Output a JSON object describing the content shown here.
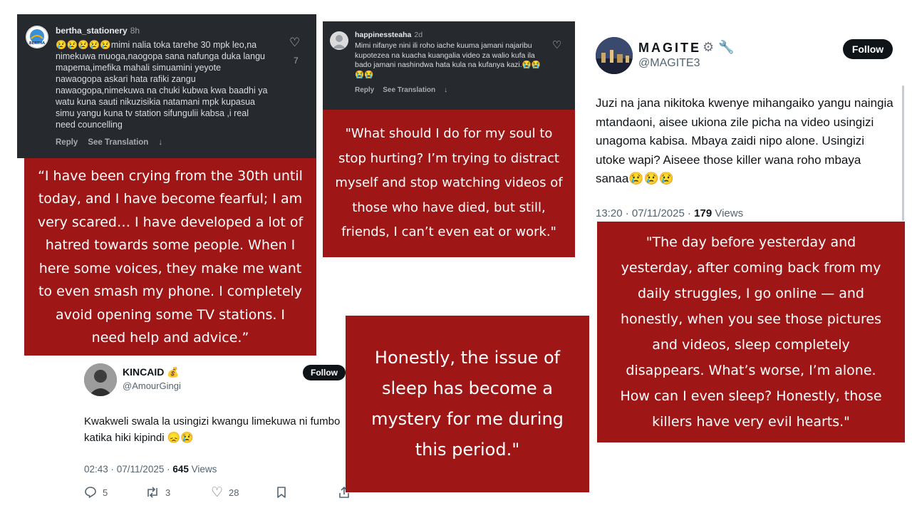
{
  "comment_bertha": {
    "username": "bertha_stationery",
    "time": "8h",
    "text": "😢😢😢😢😢mimi nalia toka tarehe 30 mpk leo,na nimekuwa muoga,naogopa sana nafunga duka langu mapema,imefika mahali simuamini yeyote nawaogopa askari hata rafiki zangu nawaogopa,nimekuwa na chuki kubwa kwa baadhi ya watu kuna sauti nikuzisikia natamani mpk kupasua simu yangu kuna tv station sifungulii kabsa ,i real need councelling",
    "likes": "7",
    "reply_label": "Reply",
    "translate_label": "See Translation",
    "avatar_label": "BERTHA"
  },
  "translation_bertha": "“I have been crying from the 30th until today, and I have become fearful; I am very scared… I have developed a lot of hatred towards some people. When I here some voices, they  make me want to even smash my phone. I completely avoid opening some TV stations. I need help and advice.”",
  "comment_happiness": {
    "username": "happinessteaha",
    "time": "2d",
    "text": "Mimi nifanye nini ili roho iache kuuma jamani najaribu kupotezea na kuacha kuangalia video za walio kufa ila bado jamani nashindwa hata kula na kufanya kazi.😭😭😭😭",
    "reply_label": "Reply",
    "translate_label": "See Translation"
  },
  "translation_happiness": "\"What should I do for my soul to stop hurting? I’m trying to distract myself and stop watching videos of those who have died, but still, friends, I can’t even eat or work.\"",
  "tweet_magite": {
    "name": "MAGITE",
    "name_icons": "⚙️🔧",
    "handle": "@MAGITE3",
    "follow_label": "Follow",
    "text": "Juzi na jana nikitoka kwenye mihangaiko yangu naingia mtandaoni, aisee ukiona zile picha na video usingizi unagoma kabisa. Mbaya zaidi nipo alone. Usingizi utoke wapi? Aiseee those killer wana roho mbaya sanaa😢😢😢",
    "timestamp": "13:20 · 07/11/2025 · ",
    "views_count": "179",
    "views_label": " Views"
  },
  "translation_magite": "\"The day before yesterday and yesterday, after coming back from my daily struggles, I go online — and honestly, when you see those pictures and videos, sleep completely disappears. What’s worse, I’m alone. How can I even sleep? Honestly, those killers have very evil hearts.\"",
  "tweet_kincaid": {
    "name": "KINCAID 💰",
    "handle": "@AmourGingi",
    "follow_label": "Follow",
    "text": "Kwakweli swala la usingizi kwangu limekuwa ni fumbo katika hiki kipindi 😞😢",
    "timestamp": "02:43 · 07/11/2025 · ",
    "views_count": "645",
    "views_label": " Views",
    "replies": "5",
    "retweets": "3",
    "likes": "28"
  },
  "translation_kincaid": "Honestly, the issue of sleep has become a mystery for me during this period.\"",
  "colors": {
    "panel_red": "#9e1616",
    "dark_card": "#262a2f",
    "follow_button": "#0f1419"
  },
  "icons": [
    "heart-icon",
    "arrow-down-icon",
    "gear-icon",
    "wrench-icon",
    "reply-icon",
    "retweet-icon",
    "bookmark-icon",
    "share-icon"
  ]
}
